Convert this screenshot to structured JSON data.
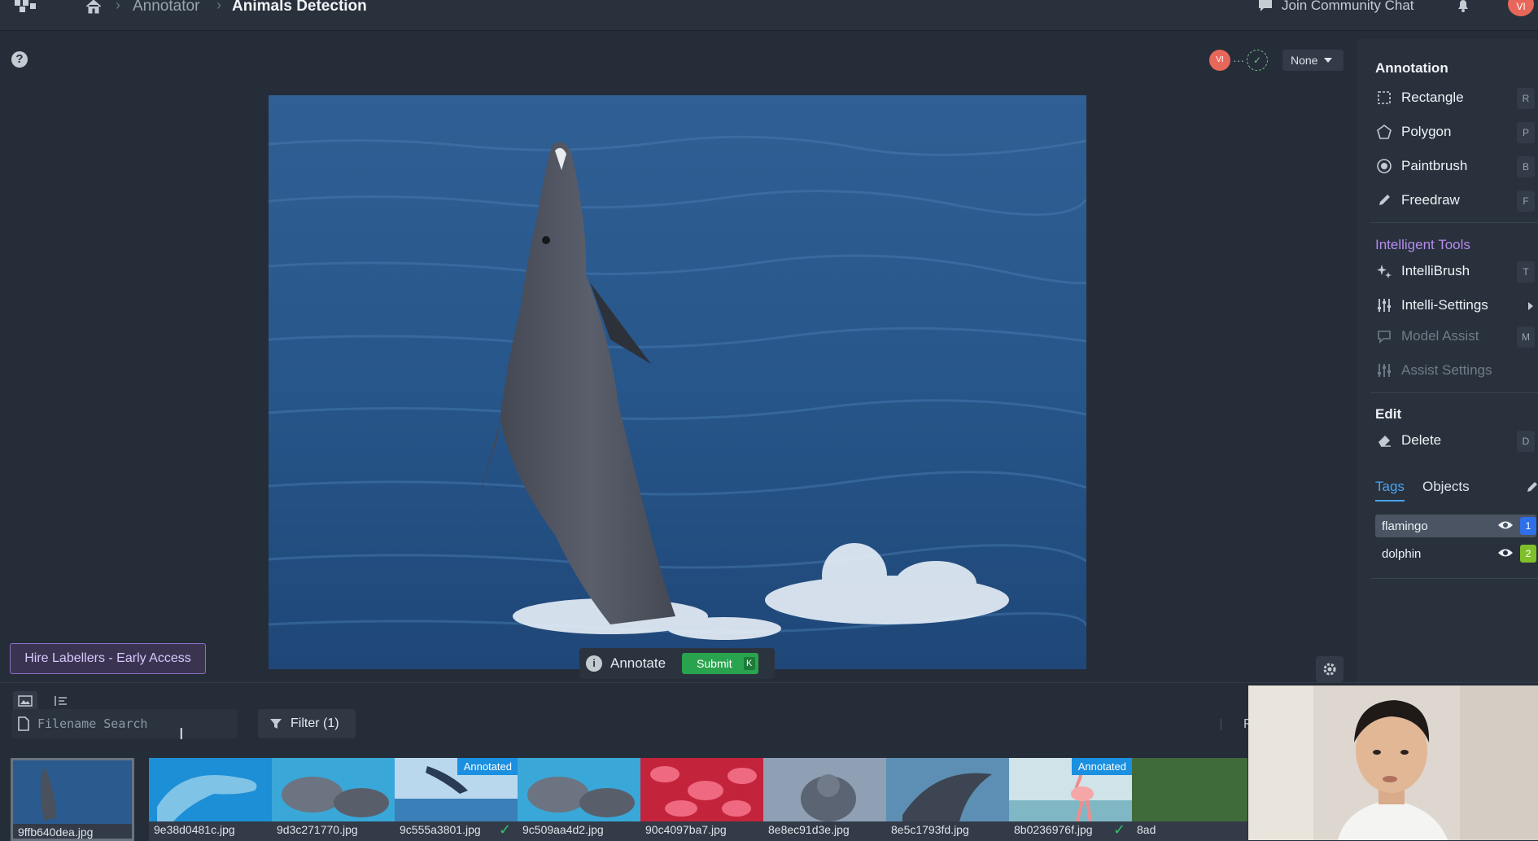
{
  "breadcrumb": {
    "first": "Annotator",
    "current": "Animals Detection"
  },
  "topbar": {
    "community": "Join Community Chat",
    "avatar": "VI"
  },
  "canvas": {
    "reviewer_a": "VI",
    "review_status": "None",
    "annotate_label": "Annotate",
    "submit_label": "Submit",
    "submit_key": "K"
  },
  "hire_button": "Hire Labellers - Early Access",
  "panel": {
    "annotation_title": "Annotation",
    "tools": [
      {
        "label": "Rectangle",
        "key": "R",
        "icon": "rectangle-icon"
      },
      {
        "label": "Polygon",
        "key": "P",
        "icon": "polygon-icon"
      },
      {
        "label": "Paintbrush",
        "key": "B",
        "icon": "paintbrush-icon"
      },
      {
        "label": "Freedraw",
        "key": "F",
        "icon": "pencil-icon"
      }
    ],
    "intelligent_title": "Intelligent Tools",
    "intelligent": [
      {
        "label": "IntelliBrush",
        "key": "T"
      },
      {
        "label": "Intelli-Settings"
      },
      {
        "label": "Model Assist",
        "key": "M"
      },
      {
        "label": "Assist Settings"
      }
    ],
    "edit_title": "Edit",
    "delete": {
      "label": "Delete",
      "key": "D"
    },
    "tabs": {
      "tags": "Tags",
      "objects": "Objects"
    },
    "tags": [
      {
        "name": "flamingo",
        "num": "1",
        "color": "#2f6fe8"
      },
      {
        "name": "dolphin",
        "num": "2",
        "color": "#7fbf2a"
      }
    ]
  },
  "bottom": {
    "search_placeholder": "Filename Search",
    "filter_label": "Filter (1)",
    "thumbnails": [
      {
        "file": "9ffb640dea.jpg",
        "annotated": false
      },
      {
        "file": "9e38d0481c.jpg",
        "annotated": false
      },
      {
        "file": "9d3c271770.jpg",
        "annotated": false
      },
      {
        "file": "9c555a3801.jpg",
        "annotated": true,
        "badge": "Annotated"
      },
      {
        "file": "9c509aa4d2.jpg",
        "annotated": false
      },
      {
        "file": "90c4097ba7.jpg",
        "annotated": false
      },
      {
        "file": "8e8ec91d3e.jpg",
        "annotated": false
      },
      {
        "file": "8e5c1793fd.jpg",
        "annotated": false
      },
      {
        "file": "8b0236976f.jpg",
        "annotated": true,
        "badge": "Annotated"
      },
      {
        "file": "8ad",
        "annotated": false
      }
    ]
  }
}
